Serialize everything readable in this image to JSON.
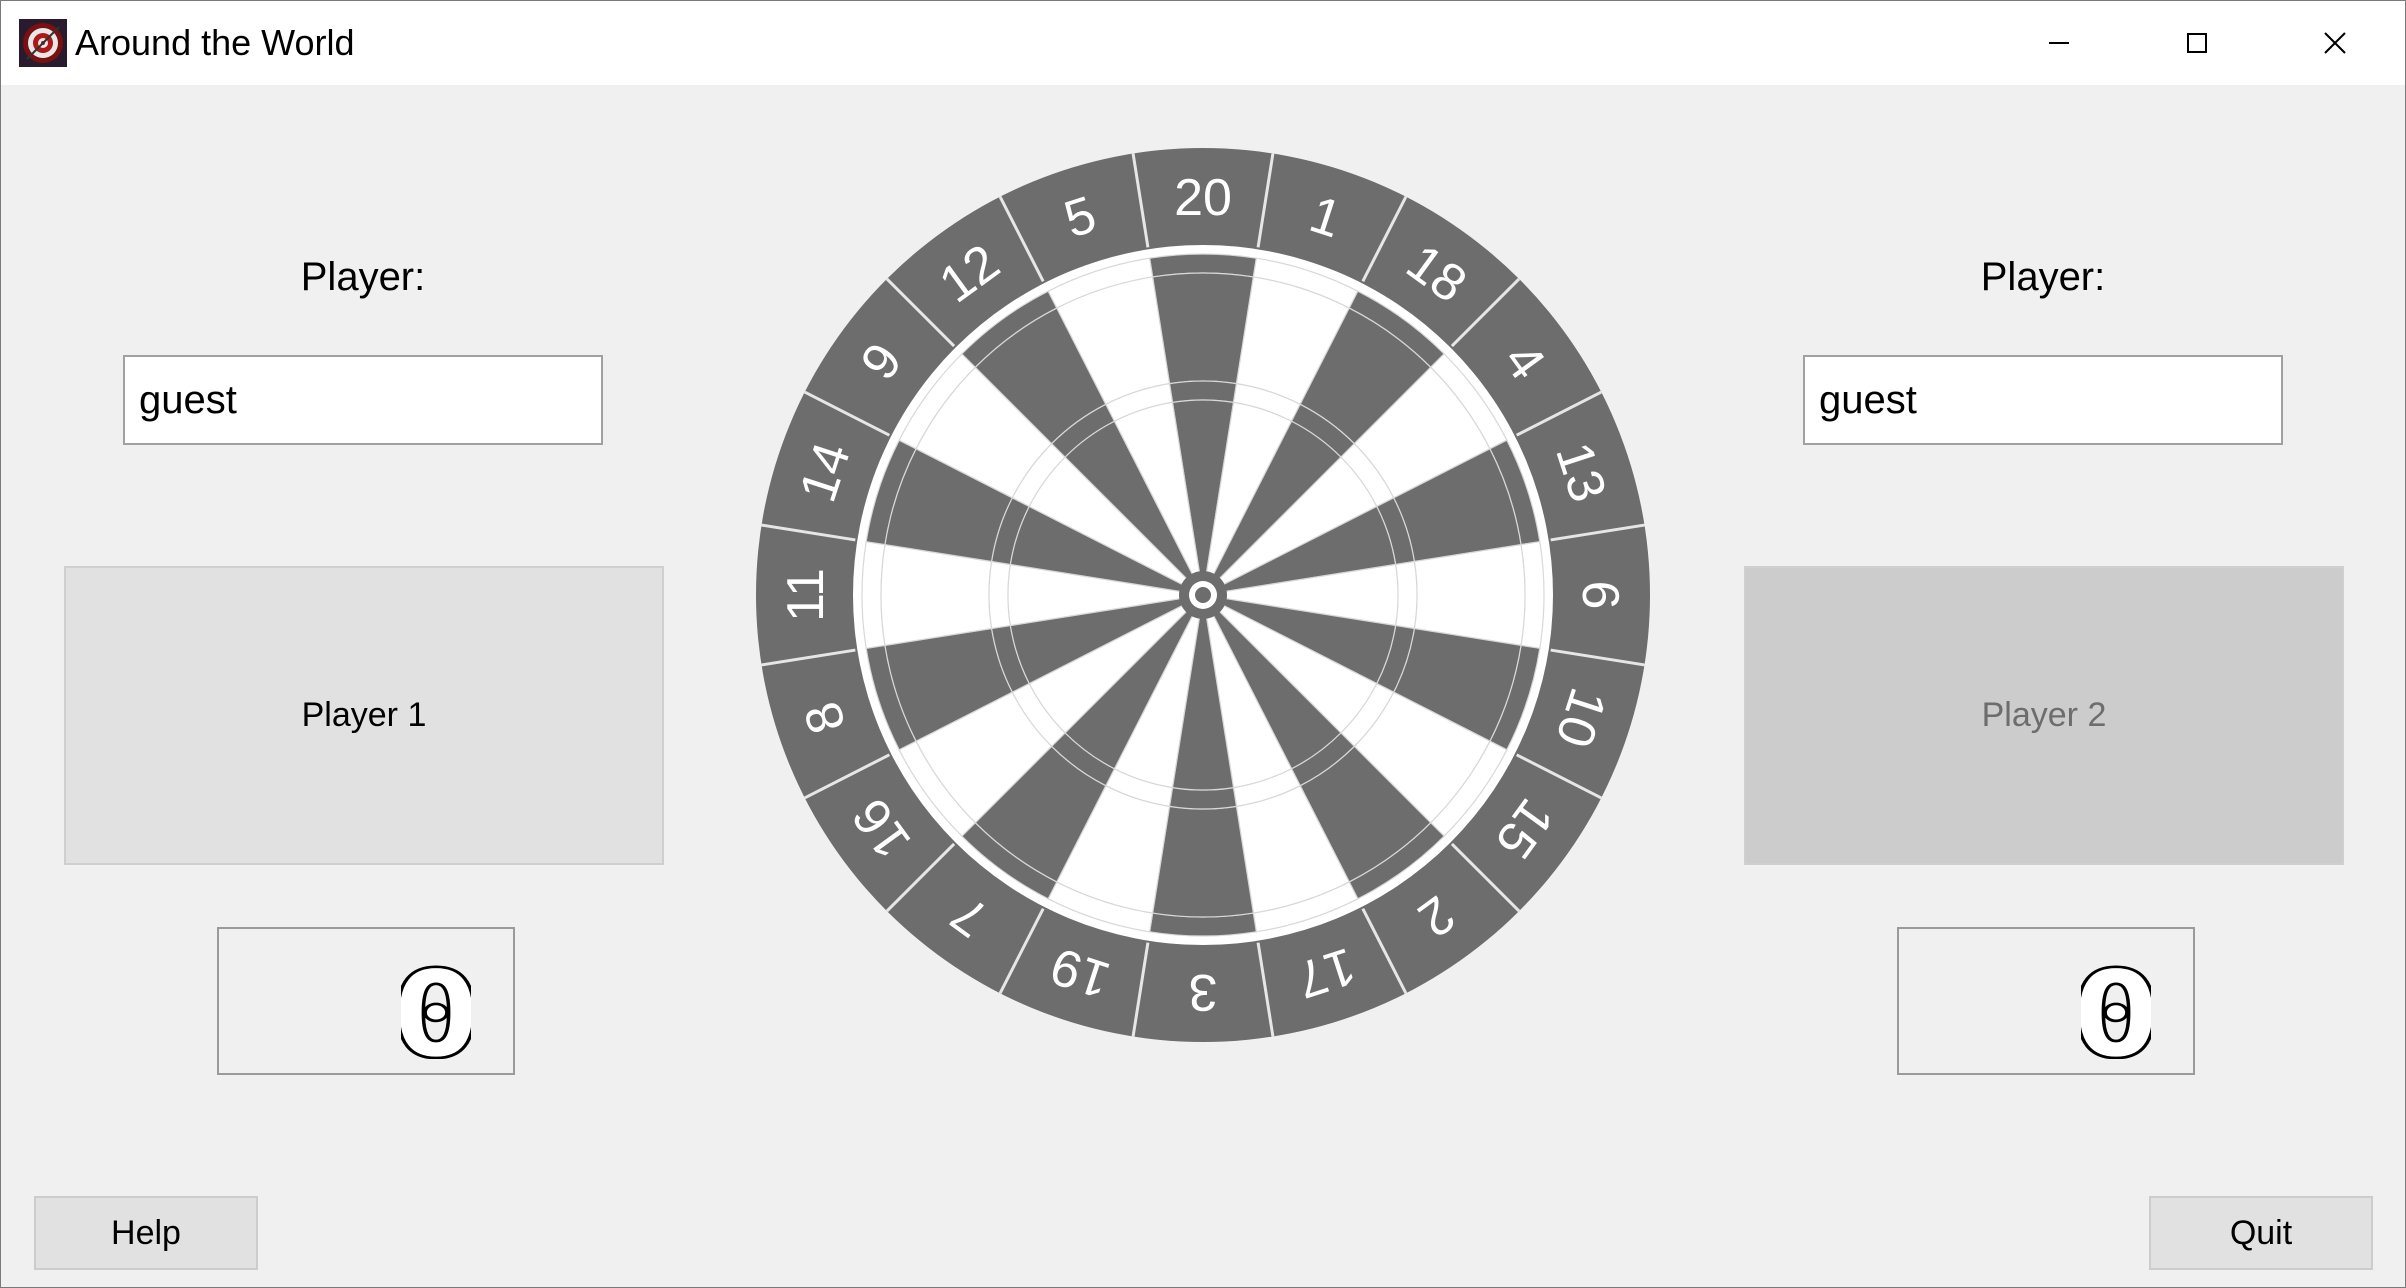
{
  "window": {
    "title": "Around the World",
    "app_icon": "dartboard-icon",
    "controls": [
      "minimize-icon",
      "maximize-icon",
      "close-icon"
    ]
  },
  "left_player": {
    "label": "Player:",
    "name": "guest",
    "button_label": "Player 1",
    "score": "0"
  },
  "right_player": {
    "label": "Player:",
    "name": "guest",
    "button_label": "Player 2",
    "score": "0"
  },
  "dartboard": {
    "numbers": [
      "20",
      "1",
      "18",
      "4",
      "13",
      "6",
      "10",
      "15",
      "2",
      "17",
      "3",
      "19",
      "7",
      "16",
      "8",
      "11",
      "14",
      "9",
      "12",
      "5"
    ],
    "colors": {
      "dark": "#6d6d6d",
      "light": "#ffffff"
    }
  },
  "buttons": {
    "help": "Help",
    "quit": "Quit"
  }
}
